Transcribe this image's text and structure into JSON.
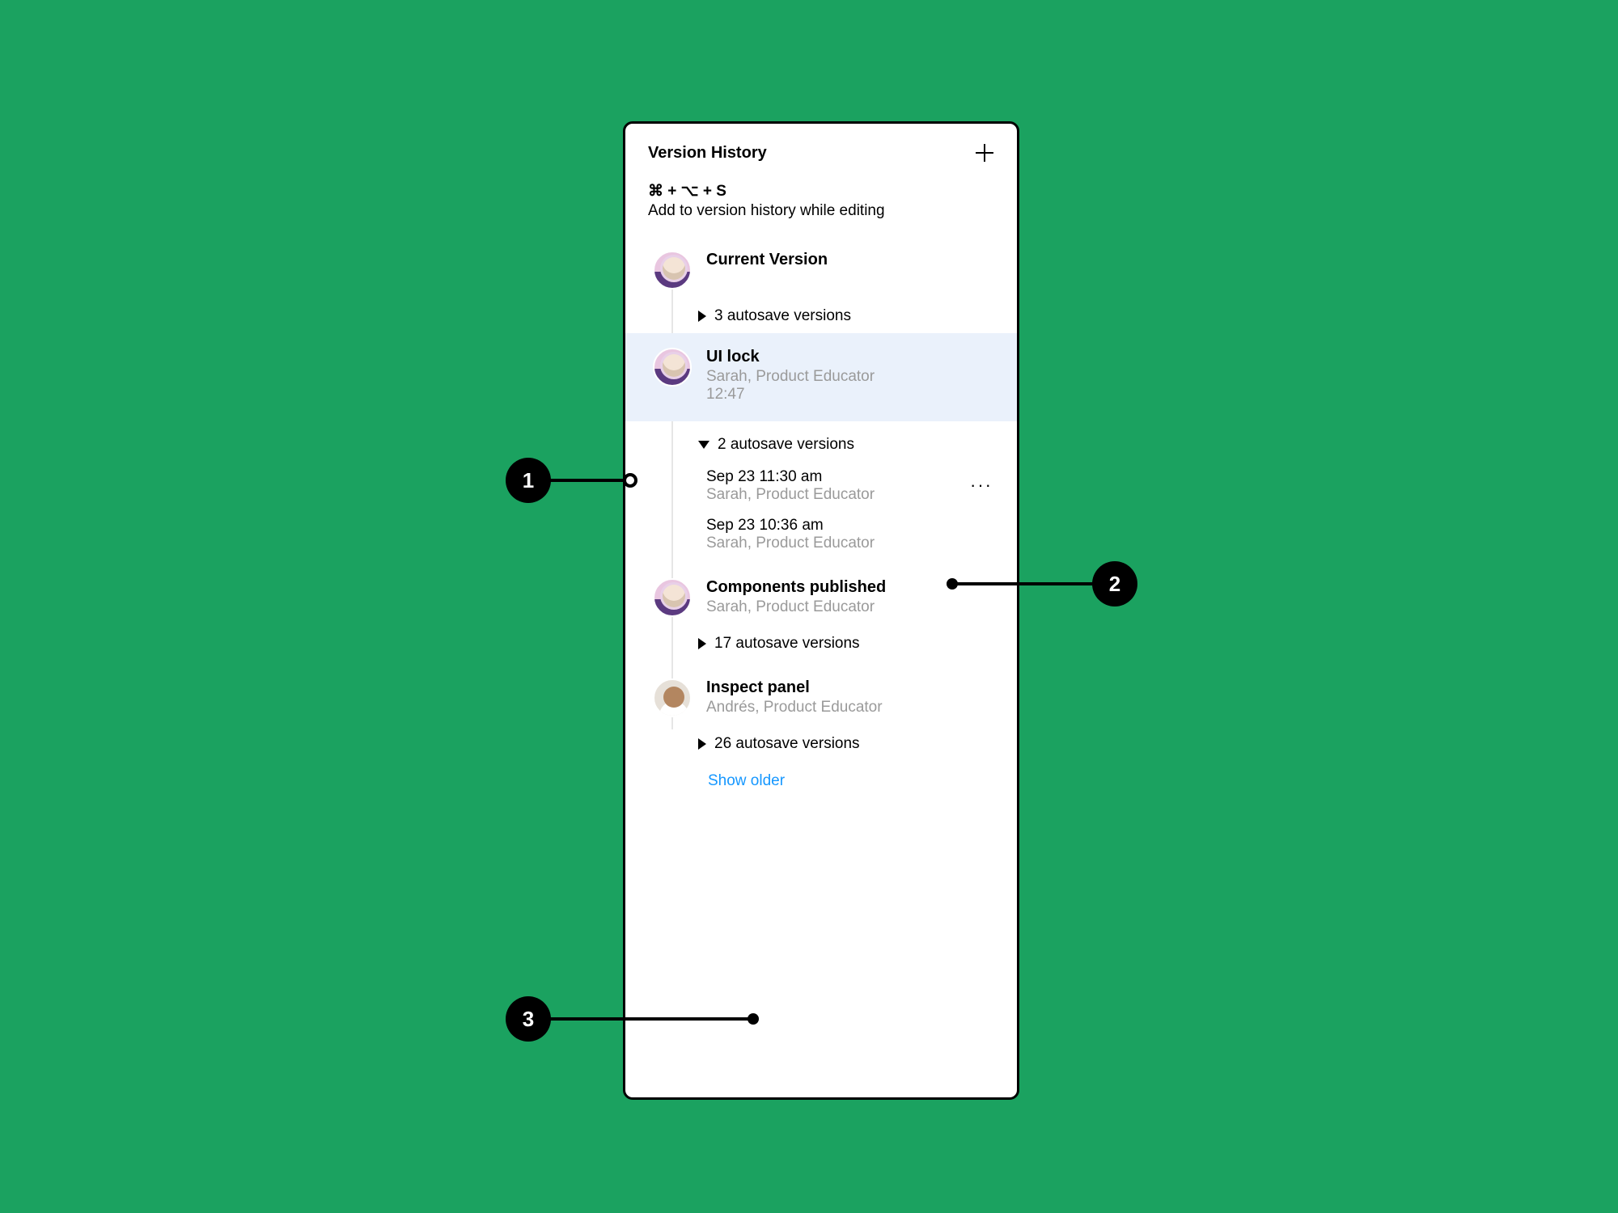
{
  "panel": {
    "title": "Version History",
    "hint_keys": "⌘ + ⌥ + S",
    "hint_text": "Add to version history while editing"
  },
  "versions": {
    "current": {
      "title": "Current Version",
      "autosave_label": "3 autosave versions"
    },
    "ui_lock": {
      "title": "UI lock",
      "author": "Sarah, Product Educator",
      "time": "12:47",
      "autosave_label": "2 autosave versions",
      "entries": [
        {
          "time": "Sep 23 11:30 am",
          "author": "Sarah, Product Educator"
        },
        {
          "time": "Sep 23 10:36 am",
          "author": "Sarah, Product Educator"
        }
      ]
    },
    "components": {
      "title": "Components published",
      "author": "Sarah, Product Educator",
      "autosave_label": "17 autosave versions"
    },
    "inspect": {
      "title": "Inspect panel",
      "author": "Andrés, Product Educator",
      "autosave_label": "26 autosave versions"
    }
  },
  "show_older": "Show older",
  "callouts": {
    "c1": "1",
    "c2": "2",
    "c3": "3"
  }
}
